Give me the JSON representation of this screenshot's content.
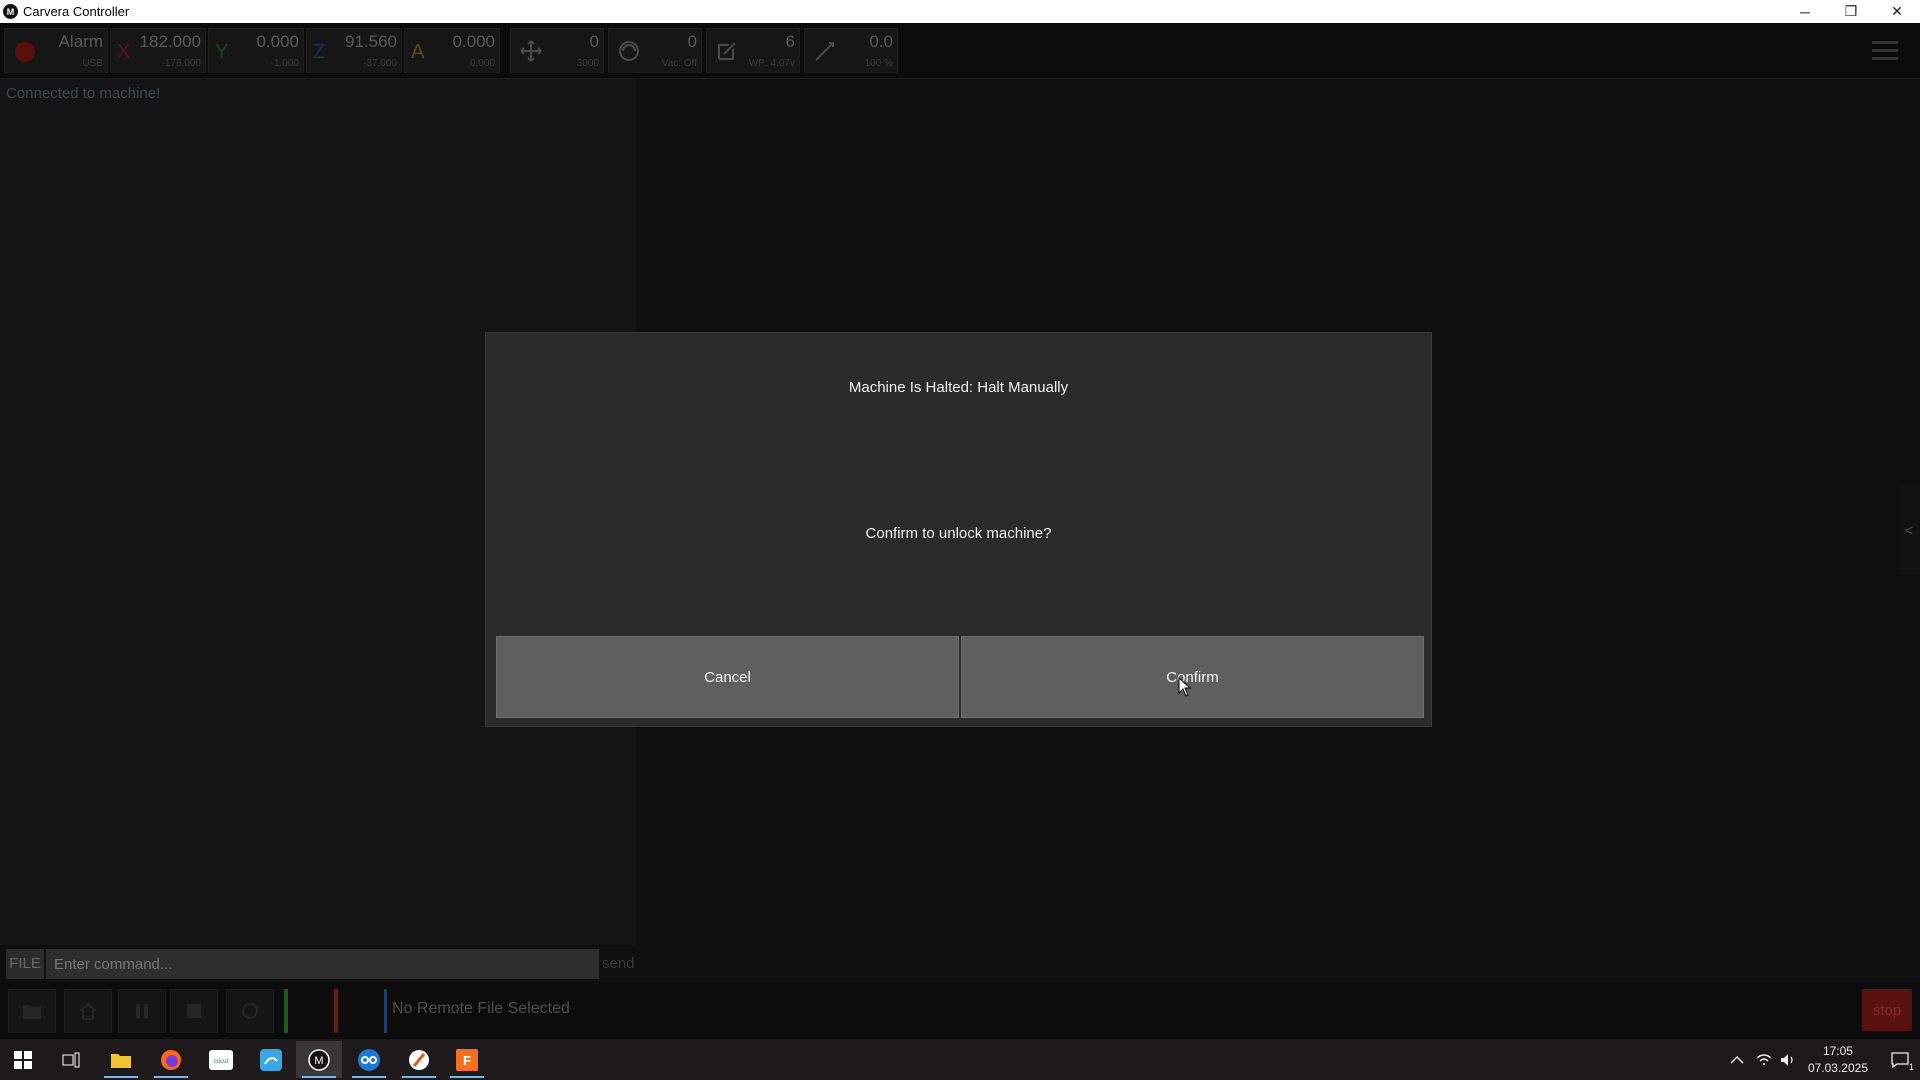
{
  "window": {
    "title": "Carvera Controller",
    "app_icon_label": "M",
    "minimize": "─",
    "restore": "❐",
    "close": "✕"
  },
  "status": {
    "state": "Alarm",
    "connection": "USB",
    "x": {
      "axis": "X",
      "value": "182.000",
      "sub": "-178.000",
      "color": "#5a1616"
    },
    "y": {
      "axis": "Y",
      "value": "0.000",
      "sub": "-1.000",
      "color": "#164a16"
    },
    "z": {
      "axis": "Z",
      "value": "91.560",
      "sub": "-37.000",
      "color": "#16305a"
    },
    "a": {
      "axis": "A",
      "value": "0.000",
      "sub": "0.000",
      "color": "#5a4a16"
    },
    "feed": {
      "value": "0",
      "sub": "3000"
    },
    "spindle": {
      "value": "0",
      "sub": "Vac: Off"
    },
    "tool": {
      "value": "6",
      "sub": "WP: 4.07v"
    },
    "laser": {
      "value": "0.0",
      "sub": "100 %"
    }
  },
  "console": {
    "log_line": "Connected to machine!",
    "file_label": "FILE",
    "command_placeholder": "Enter command...",
    "send_label": "send"
  },
  "bottom": {
    "remote_file": "No Remote File Selected",
    "stop_label": "stop"
  },
  "dialog": {
    "title": "Machine Is Halted: Halt Manually",
    "message": "Confirm to unlock machine?",
    "cancel_label": "Cancel",
    "confirm_label": "Confirm"
  },
  "side_handle": "<",
  "taskbar": {
    "apps": [
      "start-icon",
      "task-view-icon",
      "file-explorer-icon",
      "firefox-icon",
      "cricut-icon",
      "whiteboard-icon",
      "carvera-icon",
      "network-app-icon",
      "browser-app-icon",
      "fusion-icon"
    ],
    "time": "17:05",
    "date": "07.03.2025",
    "notification_count": "1"
  }
}
